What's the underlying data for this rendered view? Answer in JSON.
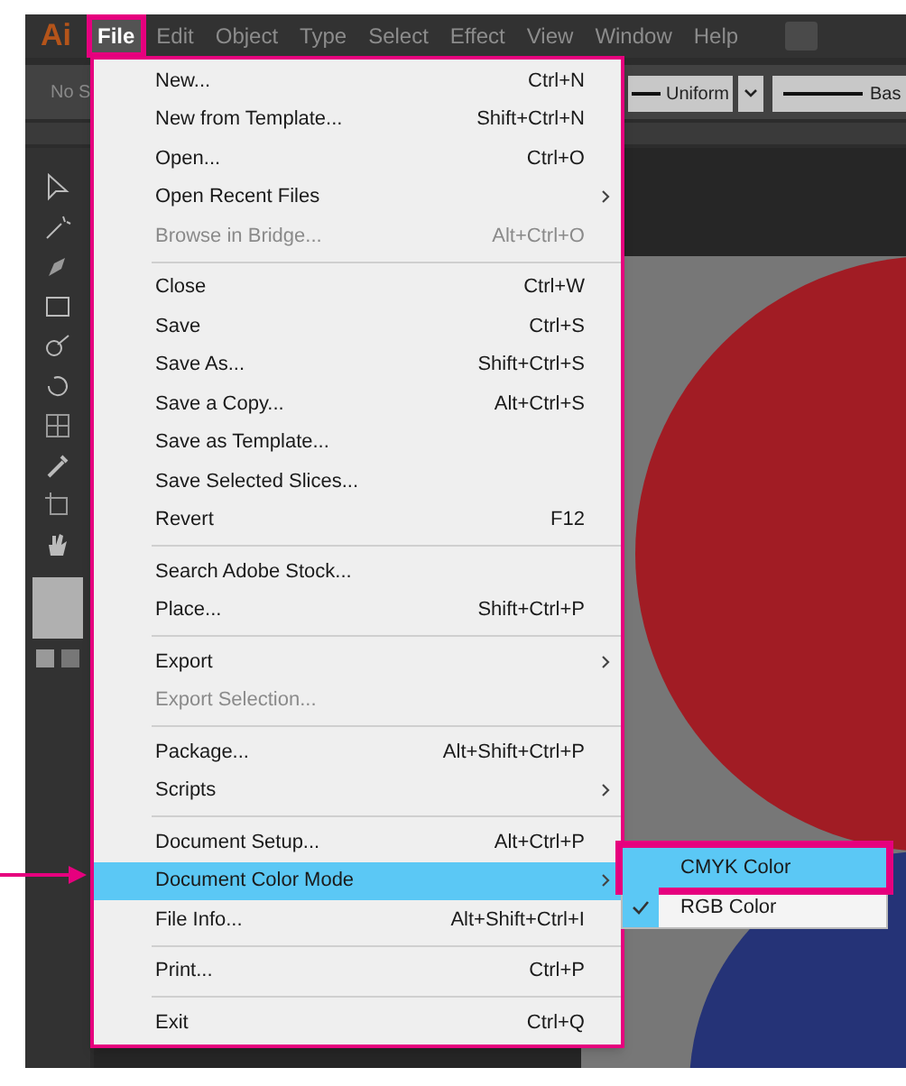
{
  "app_logo": "Ai",
  "menu_bar": [
    {
      "label": "File",
      "selected": true,
      "highlighted": true
    },
    {
      "label": "Edit",
      "selected": false,
      "highlighted": false
    },
    {
      "label": "Object",
      "selected": false,
      "highlighted": false
    },
    {
      "label": "Type",
      "selected": false,
      "highlighted": false
    },
    {
      "label": "Select",
      "selected": false,
      "highlighted": false
    },
    {
      "label": "Effect",
      "selected": false,
      "highlighted": false
    },
    {
      "label": "View",
      "selected": false,
      "highlighted": false
    },
    {
      "label": "Window",
      "selected": false,
      "highlighted": false
    },
    {
      "label": "Help",
      "selected": false,
      "highlighted": false
    }
  ],
  "control_bar": {
    "fill_label": "No S",
    "stroke_profile": "Uniform",
    "brush_label": "Bas"
  },
  "file_menu": [
    {
      "kind": "item",
      "label": "New...",
      "shortcut": "Ctrl+N",
      "submenu": false,
      "disabled": false,
      "selected": false
    },
    {
      "kind": "item",
      "label": "New from Template...",
      "shortcut": "Shift+Ctrl+N",
      "submenu": false,
      "disabled": false,
      "selected": false
    },
    {
      "kind": "item",
      "label": "Open...",
      "shortcut": "Ctrl+O",
      "submenu": false,
      "disabled": false,
      "selected": false
    },
    {
      "kind": "item",
      "label": "Open Recent Files",
      "submenu": true,
      "disabled": false,
      "selected": false
    },
    {
      "kind": "item",
      "label": "Browse in Bridge...",
      "shortcut": "Alt+Ctrl+O",
      "submenu": false,
      "disabled": true,
      "selected": false
    },
    {
      "kind": "separator"
    },
    {
      "kind": "item",
      "label": "Close",
      "shortcut": "Ctrl+W",
      "submenu": false,
      "disabled": false,
      "selected": false
    },
    {
      "kind": "item",
      "label": "Save",
      "shortcut": "Ctrl+S",
      "submenu": false,
      "disabled": false,
      "selected": false
    },
    {
      "kind": "item",
      "label": "Save As...",
      "shortcut": "Shift+Ctrl+S",
      "submenu": false,
      "disabled": false,
      "selected": false
    },
    {
      "kind": "item",
      "label": "Save a Copy...",
      "shortcut": "Alt+Ctrl+S",
      "submenu": false,
      "disabled": false,
      "selected": false
    },
    {
      "kind": "item",
      "label": "Save as Template...",
      "submenu": false,
      "disabled": false,
      "selected": false
    },
    {
      "kind": "item",
      "label": "Save Selected Slices...",
      "submenu": false,
      "disabled": false,
      "selected": false
    },
    {
      "kind": "item",
      "label": "Revert",
      "shortcut": "F12",
      "submenu": false,
      "disabled": false,
      "selected": false
    },
    {
      "kind": "separator"
    },
    {
      "kind": "item",
      "label": "Search Adobe Stock...",
      "submenu": false,
      "disabled": false,
      "selected": false
    },
    {
      "kind": "item",
      "label": "Place...",
      "shortcut": "Shift+Ctrl+P",
      "submenu": false,
      "disabled": false,
      "selected": false
    },
    {
      "kind": "separator"
    },
    {
      "kind": "item",
      "label": "Export",
      "submenu": true,
      "disabled": false,
      "selected": false
    },
    {
      "kind": "item",
      "label": "Export Selection...",
      "submenu": false,
      "disabled": true,
      "selected": false
    },
    {
      "kind": "separator"
    },
    {
      "kind": "item",
      "label": "Package...",
      "shortcut": "Alt+Shift+Ctrl+P",
      "submenu": false,
      "disabled": false,
      "selected": false
    },
    {
      "kind": "item",
      "label": "Scripts",
      "submenu": true,
      "disabled": false,
      "selected": false
    },
    {
      "kind": "separator"
    },
    {
      "kind": "item",
      "label": "Document Setup...",
      "shortcut": "Alt+Ctrl+P",
      "submenu": false,
      "disabled": false,
      "selected": false
    },
    {
      "kind": "item",
      "label": "Document Color Mode",
      "submenu": true,
      "disabled": false,
      "selected": true,
      "pointer_arrow": true
    },
    {
      "kind": "item",
      "label": "File Info...",
      "shortcut": "Alt+Shift+Ctrl+I",
      "submenu": false,
      "disabled": false,
      "selected": false
    },
    {
      "kind": "separator"
    },
    {
      "kind": "item",
      "label": "Print...",
      "shortcut": "Ctrl+P",
      "submenu": false,
      "disabled": false,
      "selected": false
    },
    {
      "kind": "separator"
    },
    {
      "kind": "item",
      "label": "Exit",
      "shortcut": "Ctrl+Q",
      "submenu": false,
      "disabled": false,
      "selected": false
    }
  ],
  "color_mode_submenu": [
    {
      "label": "CMYK Color",
      "checked": false,
      "selected": true,
      "highlighted": true
    },
    {
      "label": "RGB Color",
      "checked": true,
      "selected": false,
      "highlighted": false
    }
  ]
}
